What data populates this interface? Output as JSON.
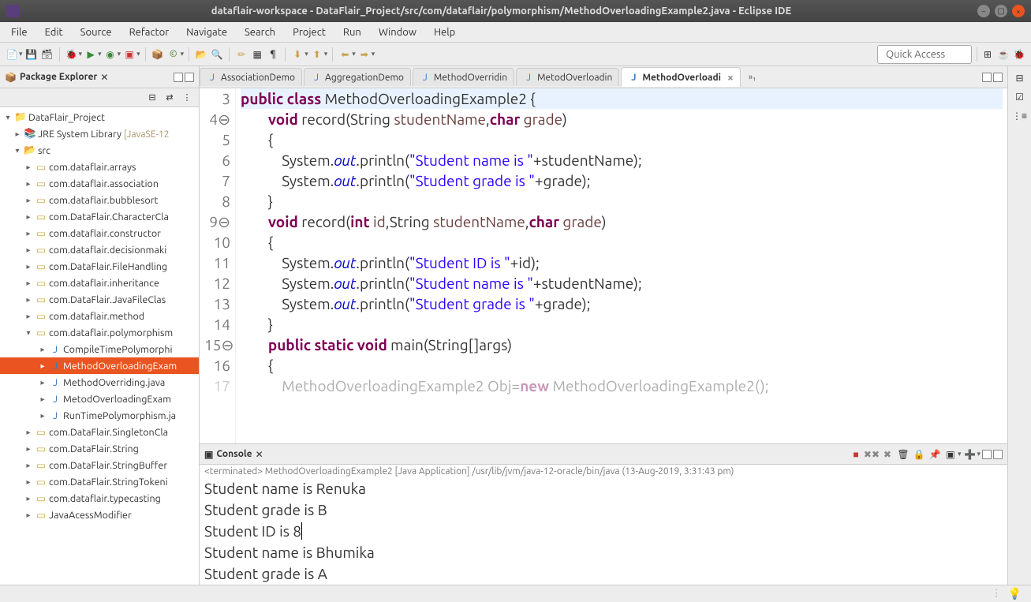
{
  "title": "dataflair-workspace - DataFlair_Project/src/com/dataflair/polymorphism/MethodOverloadingExample2.java - Eclipse IDE",
  "menu": [
    "File",
    "Edit",
    "Source",
    "Refactor",
    "Navigate",
    "Search",
    "Project",
    "Run",
    "Window",
    "Help"
  ],
  "quick_access": "Quick Access",
  "package_explorer": {
    "title": "Package Explorer",
    "project": "DataFlair_Project",
    "jre": "JRE System Library",
    "jre_tag": "[JavaSE-12",
    "src": "src",
    "packages": [
      "com.dataflair.arrays",
      "com.dataflair.association",
      "com.dataflair.bubblesort",
      "com.DataFlair.CharacterCla",
      "com.dataflair.constructor",
      "com.dataflair.decisionmaki",
      "com.DataFlair.FileHandling",
      "com.dataflair.inheritance",
      "com.DataFlair.JavaFileClas",
      "com.dataflair.method"
    ],
    "poly_pkg": "com.dataflair.polymorphism",
    "poly_files": [
      "CompileTimePolymorphi",
      "MethodOverloadingExam",
      "MethodOverriding.java",
      "MetodOverloadingExam",
      "RunTimePolymorphism.ja"
    ],
    "packages_after": [
      "com.DataFlair.SingletonCla",
      "com.DataFlair.String",
      "com.DataFlair.StringBuffer",
      "com.DataFlair.StringTokeni",
      "com.dataflair.typecasting",
      "JavaAcessModifier"
    ]
  },
  "editor": {
    "tabs": [
      "AssociationDemo",
      "AggregationDemo",
      "MethodOverridin",
      "MetodOverloadin",
      "MethodOverloadi"
    ],
    "active": "MethodOverloadi",
    "more": "»₁",
    "gutter": {
      "l3": "3",
      "l4": "4",
      "l5": "5",
      "l6": "6",
      "l7": "7",
      "l8": "8",
      "l9": "9",
      "l10": "10",
      "l11": "11",
      "l12": "12",
      "l13": "13",
      "l14": "14",
      "l15": "15",
      "l16": "16",
      "l17": "17"
    },
    "code": {
      "c3a": "public",
      "c3b": "class",
      "c3c": " MethodOverloadingExample2 {",
      "c4a": "void",
      "c4b": " record(String ",
      "c4p1": "studentName",
      "c4c": ",",
      "c4d": "char",
      "c4e": " ",
      "c4p2": "grade",
      "c4f": ")",
      "c5": "        {",
      "c6a": "            System.",
      "c6b": "out",
      "c6c": ".println(",
      "c6d": "\"Student name is \"",
      "c6e": "+studentName);",
      "c7a": "            System.",
      "c7b": "out",
      "c7c": ".println(",
      "c7d": "\"Student grade is \"",
      "c7e": "+grade);",
      "c8": "        }",
      "c9a": "void",
      "c9b": " record(",
      "c9c": "int",
      "c9d": " ",
      "c9p1": "id",
      "c9e": ",String ",
      "c9p2": "studentName",
      "c9f": ",",
      "c9g": "char",
      "c9h": " ",
      "c9p3": "grade",
      "c9i": ")",
      "c10": "        {",
      "c11a": "            System.",
      "c11b": "out",
      "c11c": ".println(",
      "c11d": "\"Student ID is \"",
      "c11e": "+id);",
      "c12a": "            System.",
      "c12b": "out",
      "c12c": ".println(",
      "c12d": "\"Student name is \"",
      "c12e": "+studentName);",
      "c13a": "            System.",
      "c13b": "out",
      "c13c": ".println(",
      "c13d": "\"Student grade is \"",
      "c13e": "+grade);",
      "c14": "        }",
      "c15a": "public",
      "c15b": "static",
      "c15c": "void",
      "c15d": " main(String[]args)",
      "c16": "        {",
      "c17a": "            MethodOverloadingExample2 Obj=",
      "c17b": "new",
      "c17c": " MethodOverloadingExample2();"
    }
  },
  "console": {
    "title": "Console",
    "info": "<terminated> MethodOverloadingExample2 [Java Application] /usr/lib/jvm/java-12-oracle/bin/java (13-Aug-2019, 3:31:43 pm)",
    "lines": {
      "l1": "Student name is Renuka",
      "l2": "Student grade is B",
      "l3a": "Student ID is 8",
      "l3b": "",
      "l4": "Student name is Bhumika",
      "l5": "Student grade is A"
    }
  }
}
